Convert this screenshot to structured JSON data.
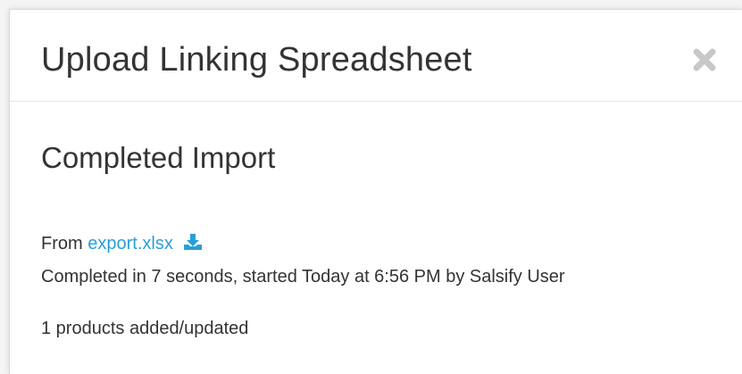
{
  "modal": {
    "title": "Upload Linking Spreadsheet",
    "close_icon": "close-x-icon"
  },
  "import": {
    "status_title": "Completed Import",
    "from_prefix": "From",
    "file_name": "export.xlsx",
    "download_icon": "download-icon",
    "completed_text": "Completed in 7 seconds, started Today at 6:56 PM by Salsify User",
    "products_text": "1 products added/updated"
  },
  "colors": {
    "link": "#2a9fd6",
    "text": "#333333",
    "close_icon": "#c8c8c8"
  }
}
